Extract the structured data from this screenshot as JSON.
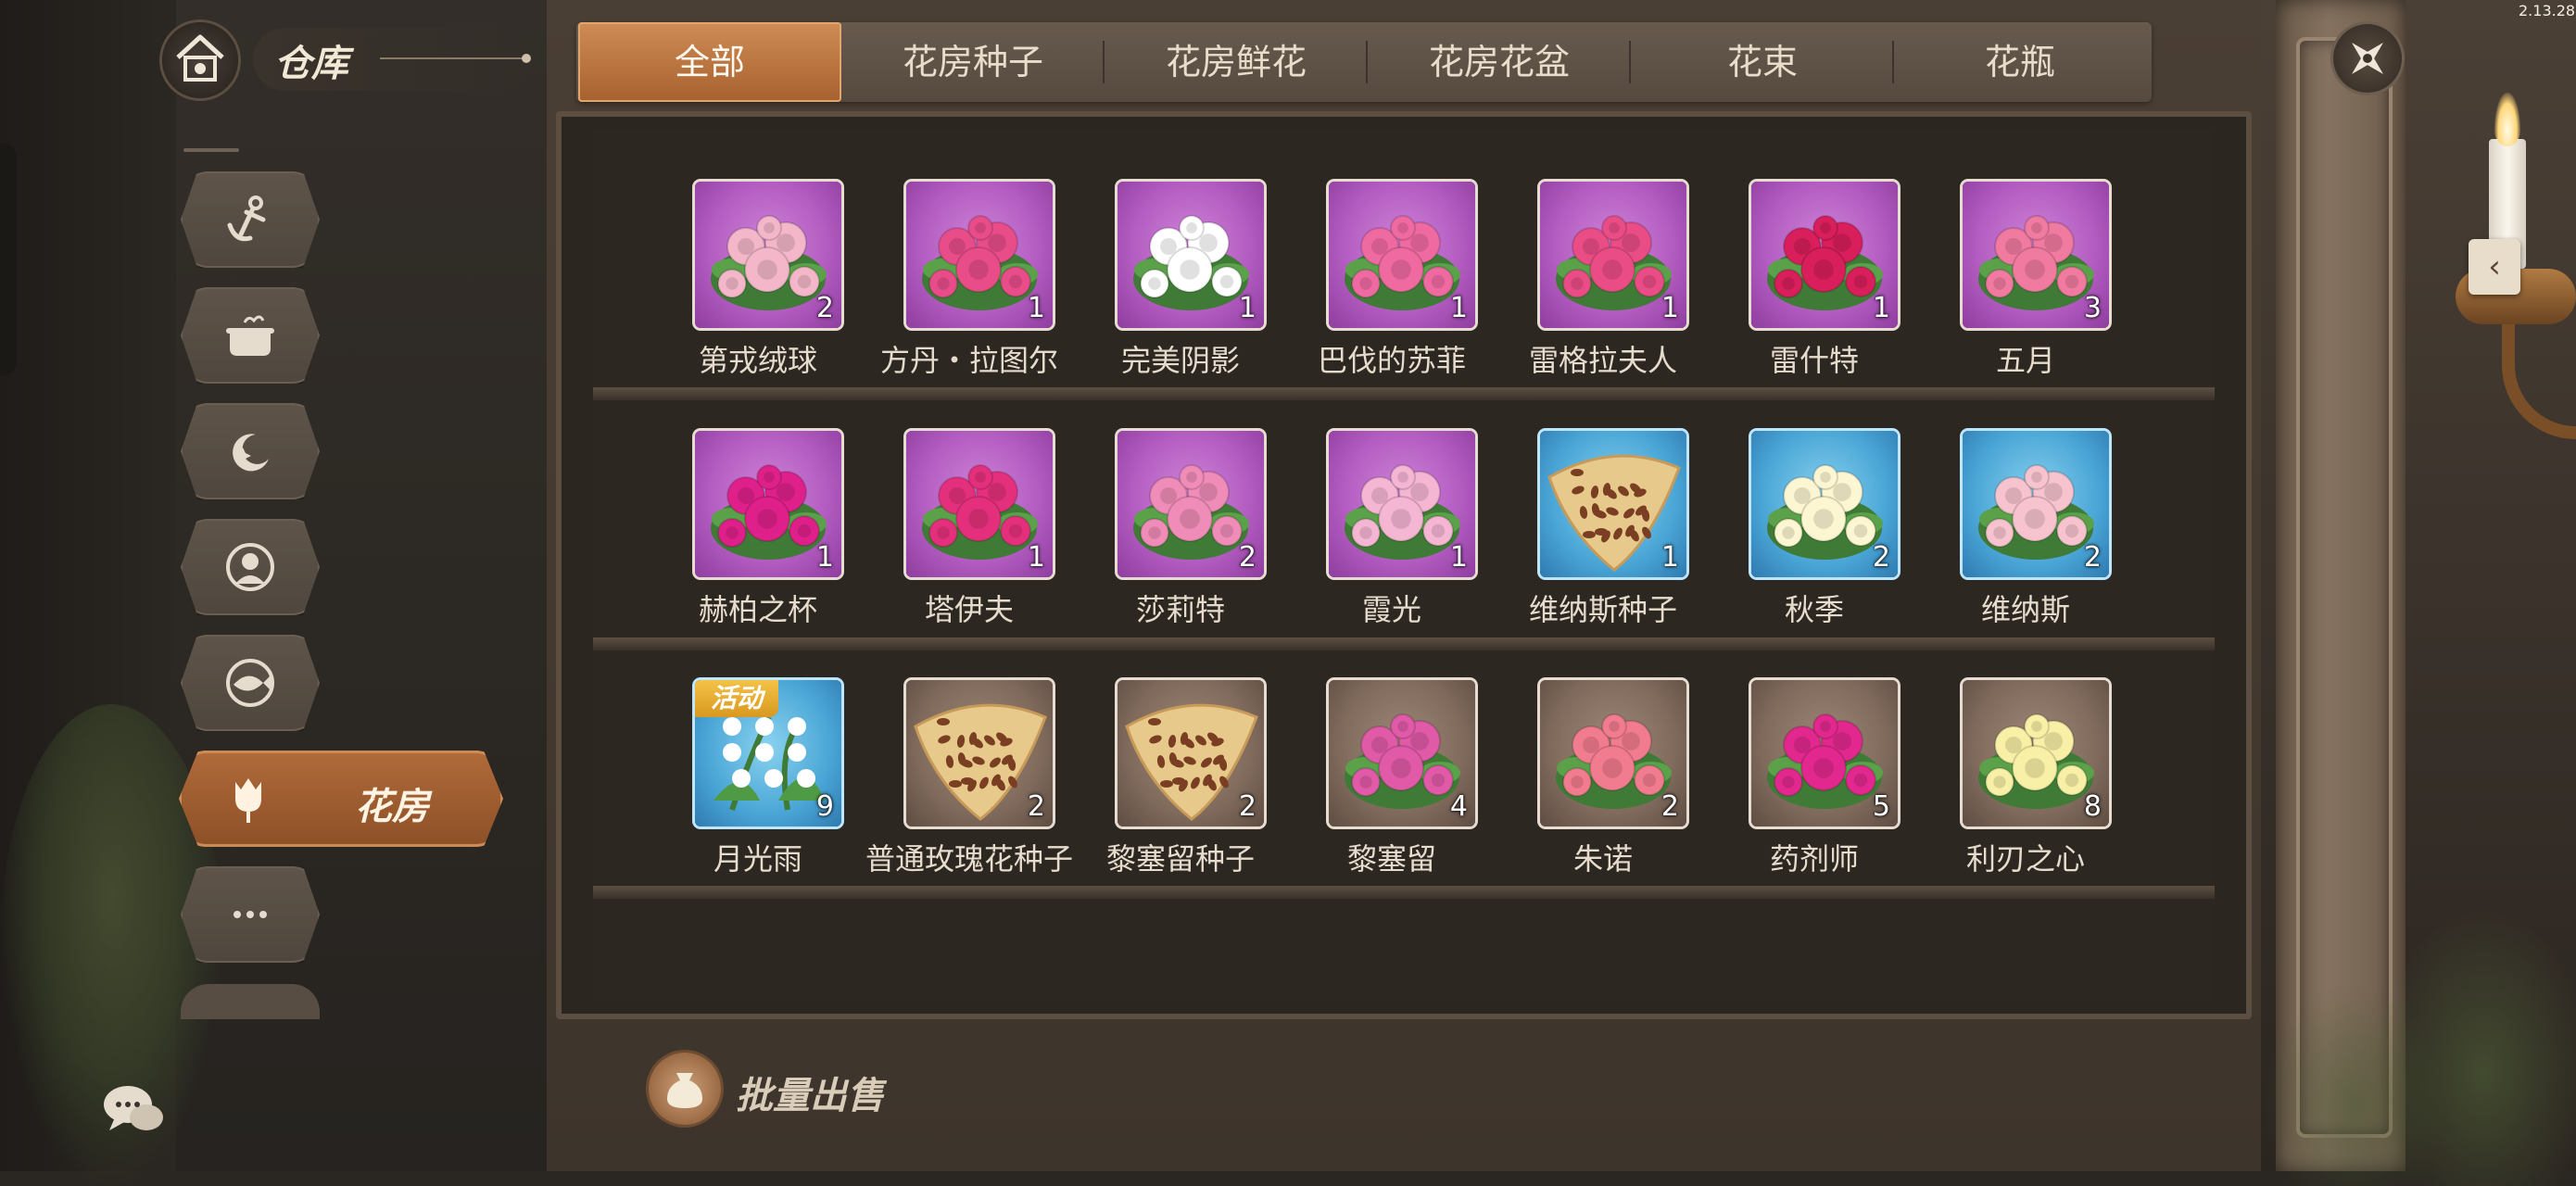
{
  "status": {
    "time": "2.13.28"
  },
  "header": {
    "title": "仓库",
    "home_icon": "home-icon"
  },
  "tabs": [
    {
      "label": "全部",
      "active": true
    },
    {
      "label": "花房种子",
      "active": false
    },
    {
      "label": "花房鲜花",
      "active": false
    },
    {
      "label": "花房花盆",
      "active": false
    },
    {
      "label": "花束",
      "active": false
    },
    {
      "label": "花瓶",
      "active": false
    }
  ],
  "sidebar": {
    "items": [
      {
        "icon": "anchor-icon"
      },
      {
        "icon": "cooking-pot-icon"
      },
      {
        "icon": "moon-sparkle-icon"
      },
      {
        "icon": "portrait-icon"
      },
      {
        "icon": "fish-icon"
      },
      {
        "icon": "tulip-icon",
        "label": "花房",
        "active": true
      },
      {
        "icon": "more-icon"
      }
    ]
  },
  "items": [
    {
      "name": "第戎绒球",
      "qty": "2",
      "rarity": "purple",
      "kind": "rose",
      "petal": "#f3b7c9"
    },
    {
      "name": "方丹・拉图尔",
      "qty": "1",
      "rarity": "purple",
      "kind": "rose",
      "petal": "#e84d8a"
    },
    {
      "name": "完美阴影",
      "qty": "1",
      "rarity": "purple",
      "kind": "rose",
      "petal": "#ffffff"
    },
    {
      "name": "巴伐的苏菲",
      "qty": "1",
      "rarity": "purple",
      "kind": "rose",
      "petal": "#f06aa2"
    },
    {
      "name": "雷格拉夫人",
      "qty": "1",
      "rarity": "purple",
      "kind": "rose",
      "petal": "#ea4d86"
    },
    {
      "name": "雷什特",
      "qty": "1",
      "rarity": "purple",
      "kind": "rose",
      "petal": "#d81e5b"
    },
    {
      "name": "五月",
      "qty": "3",
      "rarity": "purple",
      "kind": "rose",
      "petal": "#f07aa0"
    },
    {
      "name": "赫柏之杯",
      "qty": "1",
      "rarity": "purple",
      "kind": "rose",
      "petal": "#e0208a"
    },
    {
      "name": "塔伊夫",
      "qty": "1",
      "rarity": "purple",
      "kind": "rose",
      "petal": "#e4307c"
    },
    {
      "name": "莎莉特",
      "qty": "2",
      "rarity": "purple",
      "kind": "rose",
      "petal": "#f08cb8"
    },
    {
      "name": "霞光",
      "qty": "1",
      "rarity": "purple",
      "kind": "rose",
      "petal": "#f5b6d3"
    },
    {
      "name": "维纳斯种子",
      "qty": "1",
      "rarity": "blue",
      "kind": "seed",
      "petal": "#7a3e22"
    },
    {
      "name": "秋季",
      "qty": "2",
      "rarity": "blue",
      "kind": "rose",
      "petal": "#fdf6d2"
    },
    {
      "name": "维纳斯",
      "qty": "2",
      "rarity": "blue",
      "kind": "rose",
      "petal": "#f6c3cf"
    },
    {
      "name": "月光雨",
      "qty": "9",
      "rarity": "blue",
      "kind": "lily",
      "petal": "#ffffff",
      "badge": "活动"
    },
    {
      "name": "普通玫瑰花种子",
      "qty": "2",
      "rarity": "brown",
      "kind": "seed",
      "petal": "#7a3e22"
    },
    {
      "name": "黎塞留种子",
      "qty": "2",
      "rarity": "brown",
      "kind": "seed",
      "petal": "#7a3e22"
    },
    {
      "name": "黎塞留",
      "qty": "4",
      "rarity": "brown",
      "kind": "rose",
      "petal": "#e05aa8"
    },
    {
      "name": "朱诺",
      "qty": "2",
      "rarity": "brown",
      "kind": "rose",
      "petal": "#f27c8f"
    },
    {
      "name": "药剂师",
      "qty": "5",
      "rarity": "brown",
      "kind": "rose",
      "petal": "#e2288e"
    },
    {
      "name": "利刃之心",
      "qty": "8",
      "rarity": "brown",
      "kind": "rose",
      "petal": "#f8f0a6"
    }
  ],
  "footer": {
    "bulk_sell_label": "批量出售"
  },
  "colors": {
    "tab_active": "#b87040",
    "card_purple": "#b45dc2",
    "card_blue": "#4aa6d6",
    "card_brown": "#7f6a5c"
  }
}
